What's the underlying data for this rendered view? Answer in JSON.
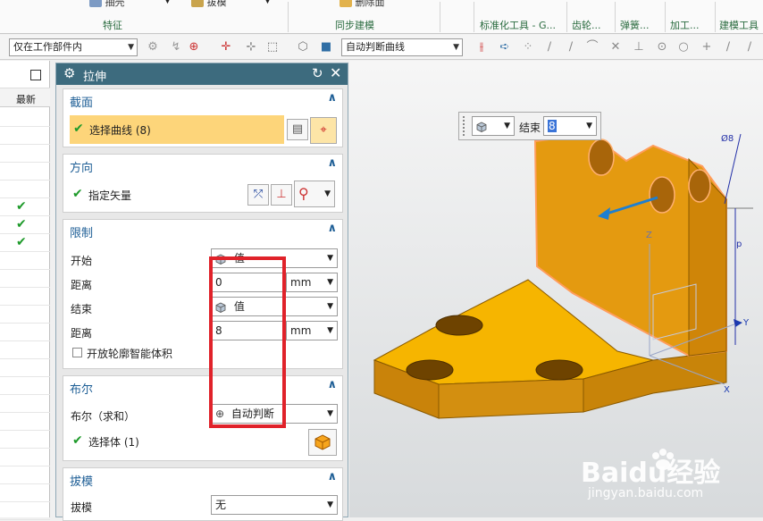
{
  "ribbon": {
    "tools": [
      "抽壳",
      "拔模",
      "删除面"
    ],
    "groups": [
      "特征",
      "同步建模",
      "标准化工具 - G...",
      "齿轮...",
      "弹簧...",
      "加工...",
      "建模工具"
    ]
  },
  "toolbar": {
    "filter_select": "仅在工作部件内",
    "curve_rule_select": "自动判断曲线"
  },
  "navigator": {
    "column_header": "最新"
  },
  "dialog": {
    "title": "拉伸",
    "section_section": {
      "title": "截面",
      "select_curve_label": "选择曲线 (8)"
    },
    "direction": {
      "title": "方向",
      "vector_label": "指定矢量"
    },
    "limits": {
      "title": "限制",
      "start_label": "开始",
      "start_value": "值",
      "start_distance_label": "距离",
      "start_distance": "0",
      "start_unit": "mm",
      "end_label": "结束",
      "end_value": "值",
      "end_distance_label": "距离",
      "end_distance": "8",
      "end_unit": "mm",
      "open_profile_label": "开放轮廓智能体积"
    },
    "boolean": {
      "title": "布尔",
      "bool_label": "布尔（求和）",
      "bool_value": "自动判断",
      "select_body_label": "选择体 (1)"
    },
    "draft": {
      "title": "拔模",
      "draft_label": "拔模",
      "draft_value": "无"
    }
  },
  "viewport": {
    "end_label": "结束",
    "end_value": "8",
    "axis_z": "Z",
    "axis_y": "Y",
    "axis_x": "X",
    "dim_d8": "Ø8",
    "dim_p": "p",
    "watermark_brand": "Baidu经验",
    "watermark_url": "jingyan.baidu.com"
  },
  "colors": {
    "dialog_title_bg": "#3d6b7e",
    "section_title": "#1f5f96",
    "highlight": "#fdd57a",
    "part_orange": "#f0a50f",
    "annotation_red": "#e0222a"
  }
}
